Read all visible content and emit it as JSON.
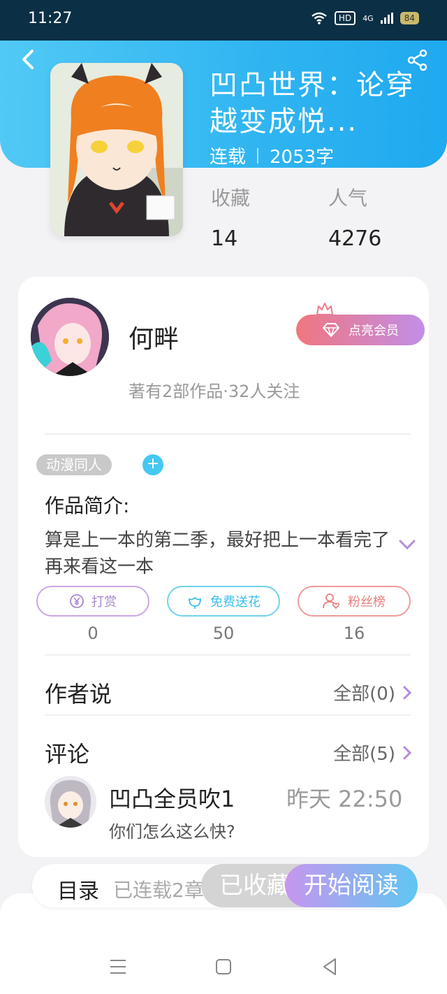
{
  "status_bar": {
    "time": "11:27",
    "hd": "HD",
    "network": "4G",
    "battery": "84"
  },
  "book": {
    "title": "凹凸世界：论穿越变成悦...",
    "state": "连载",
    "words": "2053字",
    "stats": [
      {
        "label": "收藏",
        "value": "14"
      },
      {
        "label": "人气",
        "value": "4276"
      }
    ]
  },
  "author": {
    "name": "何畔",
    "vip_label": "点亮会员",
    "subtitle": "著有2部作品·32人关注"
  },
  "tags": [
    "动漫同人"
  ],
  "intro": {
    "heading": "作品简介:",
    "text": "算是上一本的第二季，最好把上一本看完了再来看这一本"
  },
  "actions": [
    {
      "label": "打赏",
      "count": "0",
      "icon": "yen-icon"
    },
    {
      "label": "免费送花",
      "count": "50",
      "icon": "flower-icon"
    },
    {
      "label": "粉丝榜",
      "count": "16",
      "icon": "fan-icon"
    }
  ],
  "author_says": {
    "title": "作者说",
    "link": "全部(0)"
  },
  "comments": {
    "title": "评论",
    "link": "全部(5)",
    "items": [
      {
        "user": "凹凸全员吹1",
        "time": "昨天 22:50",
        "text": "你们怎么这么快?"
      }
    ]
  },
  "bottom_bar": {
    "toc_label": "目录",
    "toc_sub": "已连载2章",
    "fav_label": "已收藏",
    "read_label": "开始阅读"
  },
  "colors": {
    "header": "#2fb4f1",
    "vip_gradient": [
      "#f0767f",
      "#c28ee8"
    ],
    "read_gradient": [
      "#c796ef",
      "#5fc6f2"
    ]
  }
}
